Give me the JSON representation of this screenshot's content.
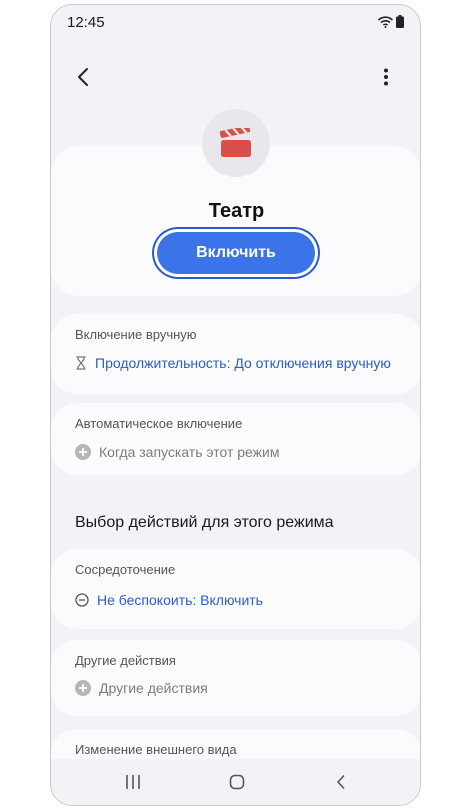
{
  "status_bar": {
    "time": "12:45",
    "icons": [
      "wifi-icon",
      "battery-icon"
    ]
  },
  "header": {
    "back_icon": "chevron-left-icon",
    "more_icon": "more-vertical-icon"
  },
  "mode": {
    "icon": "clapperboard-icon",
    "title": "Театр",
    "enable_label": "Включить"
  },
  "manual_card": {
    "title": "Включение вручную",
    "row_icon": "hourglass-icon",
    "row_text": "Продолжительность: До отключения вручную"
  },
  "auto_card": {
    "title": "Автоматическое включение",
    "row_icon": "plus-circle-icon",
    "row_text": "Когда запускать этот режим"
  },
  "actions_heading": "Выбор действий для этого режима",
  "focus_card": {
    "title": "Сосредоточение",
    "row_icon": "minus-circle-icon",
    "row_text": "Не беспокоить: Включить"
  },
  "other_card": {
    "title": "Другие действия",
    "row_icon": "plus-circle-icon",
    "row_text": "Другие действия"
  },
  "appearance_card": {
    "title": "Изменение внешнего вида"
  },
  "nav": {
    "icons": [
      "recents-icon",
      "home-icon",
      "back-icon"
    ]
  },
  "colors": {
    "accent": "#3b73e8",
    "link": "#2a5dbf",
    "background": "#f3f3f7",
    "card": "#fbfbfd",
    "clapper": "#d9504a"
  }
}
